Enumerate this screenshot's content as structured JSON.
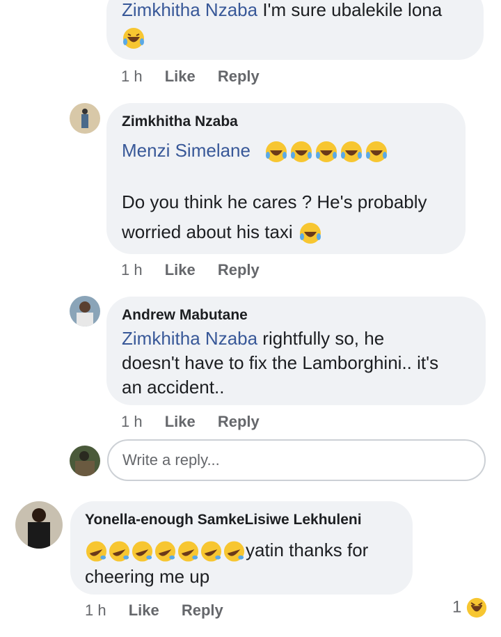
{
  "comments": [
    {
      "mention": "Zimkhitha Nzaba",
      "text": "I'm sure ubalekile lona",
      "emoji_line": "laughing-tears",
      "meta": {
        "time": "1 h",
        "like": "Like",
        "reply": "Reply"
      }
    },
    {
      "author": "Zimkhitha Nzaba",
      "mention": "Menzi Simelane",
      "emoji_count": "5",
      "line2": "Do you think he cares ? He's probably",
      "line3": "worried about his taxi",
      "meta": {
        "time": "1 h",
        "like": "Like",
        "reply": "Reply"
      }
    },
    {
      "author": "Andrew Mabutane",
      "mention": "Zimkhitha Nzaba",
      "line1": " rightfully so, he",
      "line2": "doesn't have to fix the Lamborghini.. it's",
      "line3": "an accident..",
      "meta": {
        "time": "1 h",
        "like": "Like",
        "reply": "Reply"
      }
    },
    {
      "author": "Yonella-enough SamkeLisiwe Lekhuleni",
      "line1": "yatin thanks for",
      "line2": "cheering me up",
      "meta": {
        "time": "1 h",
        "like": "Like",
        "reply": "Reply"
      },
      "reaction_count": "1"
    }
  ],
  "reply_input": {
    "placeholder": "Write a reply..."
  },
  "colors": {
    "bubble": "#f0f2f5",
    "mention": "#385898",
    "meta": "#65676b"
  }
}
